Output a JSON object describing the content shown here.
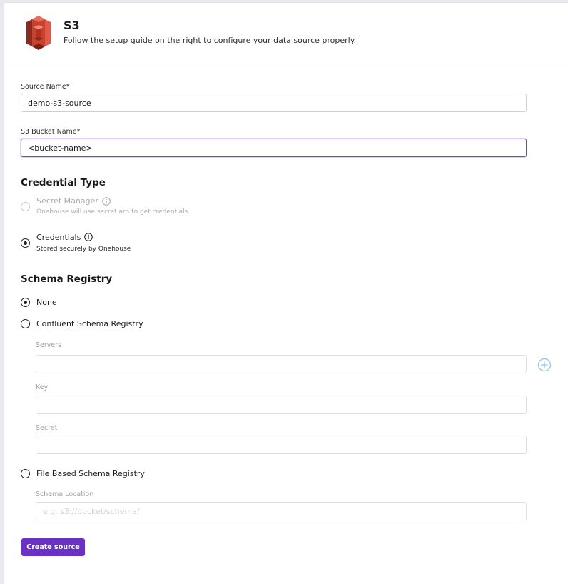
{
  "header": {
    "title": "S3",
    "subtitle": "Follow the setup guide on the right to configure your data source properly."
  },
  "form": {
    "source_name_label": "Source Name*",
    "source_name_value": "demo-s3-source",
    "bucket_label": "S3 Bucket Name*",
    "bucket_value": "<bucket-name>"
  },
  "credential_type": {
    "heading": "Credential Type",
    "options": [
      {
        "label": "Secret Manager",
        "sub": "Onehouse will use secret arn to get credentials.",
        "selected": false,
        "disabled": true
      },
      {
        "label": "Credentials",
        "sub": "Stored securely by Onehouse",
        "selected": true,
        "disabled": false
      }
    ]
  },
  "schema_registry": {
    "heading": "Schema Registry",
    "options": [
      {
        "label": "None",
        "selected": true
      },
      {
        "label": "Confluent Schema Registry",
        "selected": false
      },
      {
        "label": "File Based Schema Registry",
        "selected": false
      }
    ],
    "servers_label": "Servers",
    "key_label": "Key",
    "secret_label": "Secret",
    "schema_location_label": "Schema Location",
    "schema_location_placeholder": "e.g. s3://bucket/schema/"
  },
  "actions": {
    "create_label": "Create source"
  },
  "colors": {
    "accent": "#6a32c4",
    "focus_border": "#6a4bc7",
    "plus_icon": "#9cc7e6",
    "logo_red": "#c0392b"
  }
}
